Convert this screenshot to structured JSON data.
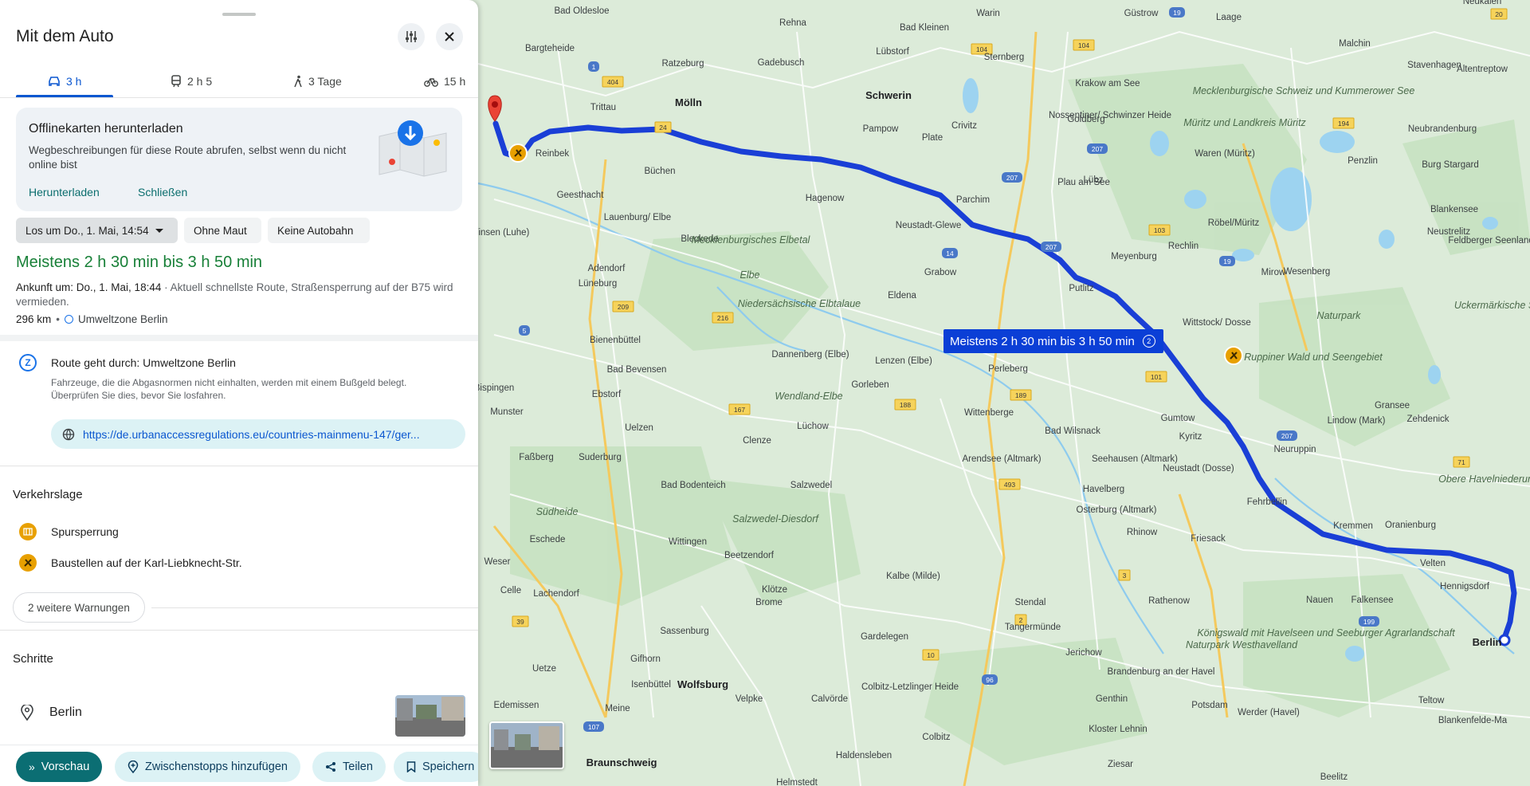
{
  "panel": {
    "title": "Mit dem Auto",
    "tabs": [
      {
        "label": "3 h",
        "icon": "car-icon"
      },
      {
        "label": "2 h 5",
        "icon": "train-icon"
      },
      {
        "label": "3 Tage",
        "icon": "walk-icon"
      },
      {
        "label": "15 h",
        "icon": "bike-icon"
      }
    ],
    "offline": {
      "title": "Offlinekarten herunterladen",
      "description": "Wegbeschreibungen für diese Route abrufen, selbst wenn du nicht online bist",
      "download_label": "Herunterladen",
      "close_label": "Schließen"
    },
    "chips": {
      "depart": "Los um Do., 1. Mai, 14:54",
      "no_toll": "Ohne Maut",
      "no_highway": "Keine Autobahn"
    },
    "route": {
      "duration": "Meistens 2 h 30 min bis 3 h 50 min",
      "arrival_label": "Ankunft um: Do., 1. Mai, 18:44",
      "arrival_note": " · Aktuell schnellste Route, Straßensperrung auf der B75 wird vermieden.",
      "distance": "296 km",
      "zone_short": "Umweltzone Berlin"
    },
    "zone": {
      "title": "Route geht durch: Umweltzone Berlin",
      "description": "Fahrzeuge, die die Abgasnormen nicht einhalten, werden mit einem Bußgeld belegt. Überprüfen Sie dies, bevor Sie losfahren.",
      "url": "https://de.urbanaccessregulations.eu/countries-mainmenu-147/ger..."
    },
    "traffic": {
      "title": "Verkehrslage",
      "warnings": [
        "Spursperrung",
        "Baustellen auf der Karl-Liebknecht-Str."
      ],
      "more_label": "2 weitere Warnungen"
    },
    "steps": {
      "title": "Schritte",
      "first": "Berlin"
    },
    "bottom": {
      "preview": "Vorschau",
      "stops": "Zwischenstopps hinzufügen",
      "share": "Teilen",
      "save": "Speichern"
    }
  },
  "map": {
    "route_label": "Meistens 2 h 30 min bis 3 h 50 min",
    "route_color": "#1a3fd6",
    "places": [
      {
        "name": "Bad Oldesloe"
      },
      {
        "name": "Rehna"
      },
      {
        "name": "Bad Kleinen"
      },
      {
        "name": "Warin"
      },
      {
        "name": "Güstrow"
      },
      {
        "name": "Laage"
      },
      {
        "name": "Neukalen"
      },
      {
        "name": "Bargteheide"
      },
      {
        "name": "Ratzeburg"
      },
      {
        "name": "Gadebusch"
      },
      {
        "name": "Lübstorf"
      },
      {
        "name": "Sternberg"
      },
      {
        "name": "Krakow am See"
      },
      {
        "name": "Malchin"
      },
      {
        "name": "Stavenhagen"
      },
      {
        "name": "Altentreptow"
      },
      {
        "name": "Trittau"
      },
      {
        "name": "Mölln"
      },
      {
        "name": "Schwerin"
      },
      {
        "name": "Pampow"
      },
      {
        "name": "Plate"
      },
      {
        "name": "Crivitz"
      },
      {
        "name": "Goldberg"
      },
      {
        "name": "Nossentiner/ Schwinzer Heide"
      },
      {
        "name": "Reinbek"
      },
      {
        "name": "Büchen"
      },
      {
        "name": "Hagenow"
      },
      {
        "name": "Parchim"
      },
      {
        "name": "Lübz"
      },
      {
        "name": "Plau am See"
      },
      {
        "name": "Waren (Müritz)"
      },
      {
        "name": "Penzlin"
      },
      {
        "name": "Neubrandenburg"
      },
      {
        "name": "Burg Stargard"
      },
      {
        "name": "Geesthacht"
      },
      {
        "name": "Lauenburg/ Elbe"
      },
      {
        "name": "Winsen (Luhe)"
      },
      {
        "name": "Neustadt-Glewe"
      },
      {
        "name": "Röbel/Müritz"
      },
      {
        "name": "Blankensee"
      },
      {
        "name": "Neustrelitz"
      },
      {
        "name": "Feldberger Seenlandsch"
      },
      {
        "name": "Grabow"
      },
      {
        "name": "Meyenburg"
      },
      {
        "name": "Rechlin"
      },
      {
        "name": "Mirow"
      },
      {
        "name": "Wesenberg"
      },
      {
        "name": "Adendorf"
      },
      {
        "name": "Bleckede"
      },
      {
        "name": "Lüneburg"
      },
      {
        "name": "Eldena"
      },
      {
        "name": "Putlitz"
      },
      {
        "name": "Wittstock/ Dosse"
      },
      {
        "name": "Bienenbüttel"
      },
      {
        "name": "Dannenberg (Elbe)"
      },
      {
        "name": "Lenzen (Elbe)"
      },
      {
        "name": "Perleberg"
      },
      {
        "name": "Bad Bevensen"
      },
      {
        "name": "Gorleben"
      },
      {
        "name": "Ebstorf"
      },
      {
        "name": "Wittenberge"
      },
      {
        "name": "Gumtow"
      },
      {
        "name": "Lindow (Mark)"
      },
      {
        "name": "Gransee"
      },
      {
        "name": "Zehdenick"
      },
      {
        "name": "Uelzen"
      },
      {
        "name": "Lüchow"
      },
      {
        "name": "Bad Wilsnack"
      },
      {
        "name": "Kyritz"
      },
      {
        "name": "Neuruppin"
      },
      {
        "name": "Clenze"
      },
      {
        "name": "Arendsee (Altmark)"
      },
      {
        "name": "Seehausen (Altmark)"
      },
      {
        "name": "Suderburg"
      },
      {
        "name": "Neustadt (Dosse)"
      },
      {
        "name": "Salzwedel"
      },
      {
        "name": "Havelberg"
      },
      {
        "name": "Fehrbellin"
      },
      {
        "name": "Bad Bodenteich"
      },
      {
        "name": "Osterburg (Altmark)"
      },
      {
        "name": "Kremmen"
      },
      {
        "name": "Oranienburg"
      },
      {
        "name": "Rhinow"
      },
      {
        "name": "Friesack"
      },
      {
        "name": "Eschede"
      },
      {
        "name": "Wittingen"
      },
      {
        "name": "Velten"
      },
      {
        "name": "Beetzendorf"
      },
      {
        "name": "Hennigsdorf"
      },
      {
        "name": "Kalbe (Milde)"
      },
      {
        "name": "Celle"
      },
      {
        "name": "Lachendorf"
      },
      {
        "name": "Klötze"
      },
      {
        "name": "Rathenow"
      },
      {
        "name": "Nauen"
      },
      {
        "name": "Falkensee"
      },
      {
        "name": "Brome"
      },
      {
        "name": "Stendal"
      },
      {
        "name": "Sassenburg"
      },
      {
        "name": "Tangermünde"
      },
      {
        "name": "Gardelegen"
      },
      {
        "name": "Uetze"
      },
      {
        "name": "Gifhorn"
      },
      {
        "name": "Jerichow"
      },
      {
        "name": "Isenbüttel"
      },
      {
        "name": "Wolfsburg"
      },
      {
        "name": "Velpke"
      },
      {
        "name": "Calvörde"
      },
      {
        "name": "Colbitz-Letzlinger Heide"
      },
      {
        "name": "Genthin"
      },
      {
        "name": "Brandenburg an der Havel"
      },
      {
        "name": "Potsdam"
      },
      {
        "name": "Teltow"
      },
      {
        "name": "Edemissen"
      },
      {
        "name": "Meine"
      },
      {
        "name": "Werder (Havel)"
      },
      {
        "name": "Blankenfelde-Ma"
      },
      {
        "name": "Colbitz"
      },
      {
        "name": "Kloster Lehnin"
      },
      {
        "name": "Braunschweig"
      },
      {
        "name": "Haldensleben"
      },
      {
        "name": "Ziesar"
      },
      {
        "name": "Helmstedt"
      },
      {
        "name": "Beelitz"
      },
      {
        "name": "Munster"
      },
      {
        "name": "Faßberg"
      },
      {
        "name": "Bispingen"
      },
      {
        "name": "Berlin"
      },
      {
        "name": "Wendland-Elbe"
      },
      {
        "name": "Mecklenburgische Schweiz und Kummerower See"
      },
      {
        "name": "Mecklenburgisches Elbetal"
      },
      {
        "name": "Niedersächsische Elbtalaue"
      },
      {
        "name": "Salzwedel-Diesdorf"
      },
      {
        "name": "Südheide"
      },
      {
        "name": "Naturpark Westhavelland"
      },
      {
        "name": "Uckermärkische Seen"
      },
      {
        "name": "Ruppiner Wald und Seengebiet"
      },
      {
        "name": "Obere Havelniederung"
      },
      {
        "name": "Königswald mit Havelseen und Seeburger Agrarlandschaft"
      },
      {
        "name": "Naturpark"
      },
      {
        "name": "Elbe"
      },
      {
        "name": "Weser"
      },
      {
        "name": "Müritz und Landkreis Müritz"
      }
    ],
    "road_numbers": [
      "24",
      "207",
      "104",
      "19",
      "20",
      "194",
      "404",
      "1",
      "14",
      "209",
      "216",
      "5",
      "103",
      "101",
      "189",
      "493",
      "167",
      "188",
      "71",
      "3",
      "2",
      "10",
      "39",
      "107",
      "199",
      "96"
    ]
  }
}
